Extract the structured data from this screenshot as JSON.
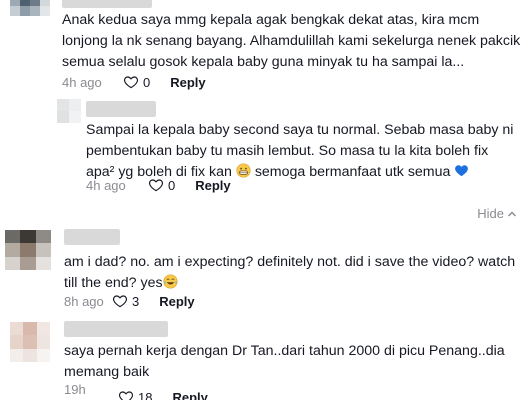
{
  "comments": [
    {
      "lines": [
        "Anak kedua saya mmg kepala agak bengkak dekat atas, kira mcm",
        "lonjong la nk senang bayang. Alhamdulillah kami sekelurga nenek pakcik",
        "semua selalu gosok kepala baby guna minyak tu ha sampai la..."
      ],
      "time": "4h ago",
      "likes": "0",
      "reply_label": "Reply"
    },
    {
      "lines": [
        "Sampai la kepala baby second saya tu normal. Sebab masa baby ni",
        "pembentukan baby tu masih lembut. So masa tu la kita boleh fix",
        "apa² yg boleh di fix kan",
        "semoga bermanfaat utk semua"
      ],
      "time": "4h ago",
      "likes": "0",
      "reply_label": "Reply"
    },
    {
      "lines": [
        "am i dad? no. am i expecting? definitely not. did i save the video? watch",
        "till the end? yes"
      ],
      "time": "8h ago",
      "likes": "3",
      "reply_label": "Reply"
    },
    {
      "lines": [
        "saya pernah kerja dengan Dr Tan..dari tahun 2000 di picu Penang..dia",
        "memang baik"
      ],
      "time": "19h ago",
      "likes": "18",
      "reply_label": "Reply"
    }
  ],
  "hide_label": "Hide",
  "icons": {
    "like": "heart-outline-icon",
    "hide": "chevron-up-icon",
    "emoji_grin": "grinning-face-icon",
    "emoji_heart": "blue-heart-icon",
    "emoji_laugh": "tears-of-joy-icon"
  },
  "colors": {
    "text": "#161823",
    "muted": "#8a8b91",
    "blue_heart": "#1e6fe0"
  }
}
